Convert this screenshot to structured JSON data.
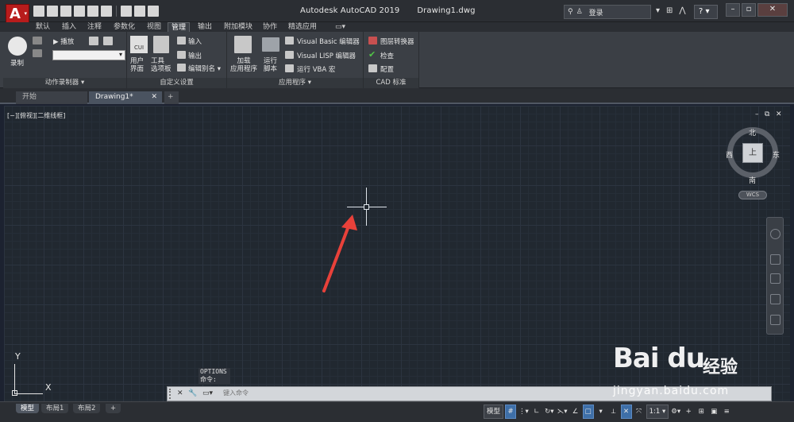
{
  "titlebar": {
    "app_name": "Autodesk AutoCAD 2019",
    "document": "Drawing1.dwg",
    "login_label": "登录",
    "help": "?"
  },
  "ribbon_tabs": [
    "默认",
    "插入",
    "注释",
    "参数化",
    "视图",
    "管理",
    "输出",
    "附加模块",
    "协作",
    "精选应用"
  ],
  "ribbon": {
    "action_recorder": {
      "record": "录制",
      "play": "播放",
      "title": "动作录制器 ▾"
    },
    "customization": {
      "user_interface_top": "CUI",
      "user_interface": "用户\n界面",
      "tool_palettes": "工具\n选项板",
      "import": "输入",
      "export": "输出",
      "edit_aliases": "编辑别名 ▾",
      "title": "自定义设置"
    },
    "applications": {
      "load_app": "加载\n应用程序",
      "run_script": "运行\n脚本",
      "vba_editor": "Visual Basic 编辑器",
      "lisp_editor": "Visual LISP 编辑器",
      "run_vba": "运行 VBA 宏",
      "title": "应用程序 ▾"
    },
    "cad_standards": {
      "layer_translator": "图层转换器",
      "check": "检查",
      "configure": "配置",
      "title": "CAD 标准"
    }
  },
  "file_tabs": [
    "开始",
    "Drawing1*",
    "+"
  ],
  "viewport": {
    "label": "[−][俯视][二维线框]"
  },
  "viewcube": {
    "north": "北",
    "south": "南",
    "east": "东",
    "west": "西",
    "face": "上",
    "wcs": "WCS"
  },
  "ucs": {
    "x": "X",
    "y": "Y"
  },
  "command": {
    "history": [
      "OPTIONS",
      "命令:"
    ],
    "placeholder": "键入命令"
  },
  "layout_tabs": [
    "模型",
    "布局1",
    "布局2",
    "+"
  ],
  "status": {
    "model": "模型",
    "scale": "1:1"
  },
  "watermark": {
    "logo": "Bai du",
    "cn": "经验",
    "url": "jingyan.baidu.com"
  }
}
